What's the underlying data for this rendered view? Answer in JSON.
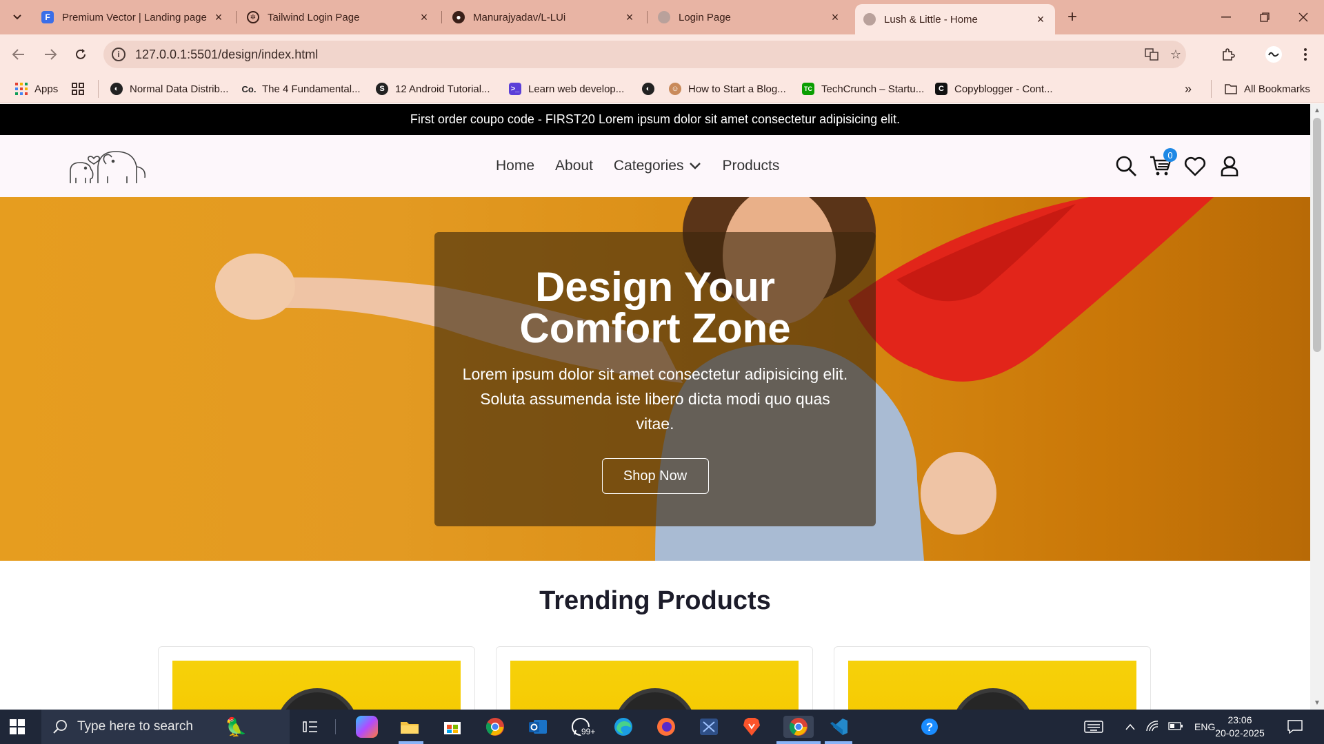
{
  "browser": {
    "tabs": [
      {
        "title": "Premium Vector | Landing page",
        "icon": "freepik-icon",
        "color": "#3b6ee8"
      },
      {
        "title": "Tailwind Login Page",
        "icon": "openai-icon",
        "color": "#3a1f18"
      },
      {
        "title": "Manurajyadav/L-LUi",
        "icon": "github-icon",
        "color": "#3a1f18"
      },
      {
        "title": "Login Page",
        "icon": "globe-icon",
        "color": "#8f7b76"
      },
      {
        "title": "Lush & Little - Home",
        "icon": "globe-icon",
        "color": "#8f7b76"
      }
    ],
    "active_tab": 4,
    "url": "127.0.0.1:5501/design/index.html",
    "bookmarks": [
      {
        "label": "Apps",
        "icon": "apps-grid-icon"
      },
      {
        "label": "",
        "icon": "tab-groups-icon"
      },
      {
        "label": "Normal Data Distrib...",
        "icon": "globe-dark-icon"
      },
      {
        "label": "The 4 Fundamental...",
        "icon": "co-icon"
      },
      {
        "label": "12 Android Tutorial...",
        "icon": "s-icon"
      },
      {
        "label": "Learn web develop...",
        "icon": "terminal-icon"
      },
      {
        "label": "",
        "icon": "globe-dark-icon"
      },
      {
        "label": "How to Start a Blog...",
        "icon": "avatar-icon"
      },
      {
        "label": "TechCrunch – Startu...",
        "icon": "tc-icon"
      },
      {
        "label": "Copyblogger - Cont...",
        "icon": "c-icon"
      }
    ],
    "all_bookmarks": "All Bookmarks"
  },
  "site": {
    "announcement": "First order coupo code - FIRST20 Lorem ipsum dolor sit amet consectetur adipisicing elit.",
    "nav": [
      "Home",
      "About",
      "Categories",
      "Products"
    ],
    "cart_count": "0",
    "hero": {
      "title_line1": "Design Your",
      "title_line2": "Comfort Zone",
      "description": "Lorem ipsum dolor sit amet consectetur adipisicing elit. Soluta assumenda iste libero dicta modi quo quas vitae.",
      "cta": "Shop Now"
    },
    "trending_title": "Trending Products"
  },
  "taskbar": {
    "search_placeholder": "Type here to search",
    "whatsapp_badge": "99+",
    "language": "ENG",
    "time": "23:06",
    "date": "20-02-2025"
  }
}
